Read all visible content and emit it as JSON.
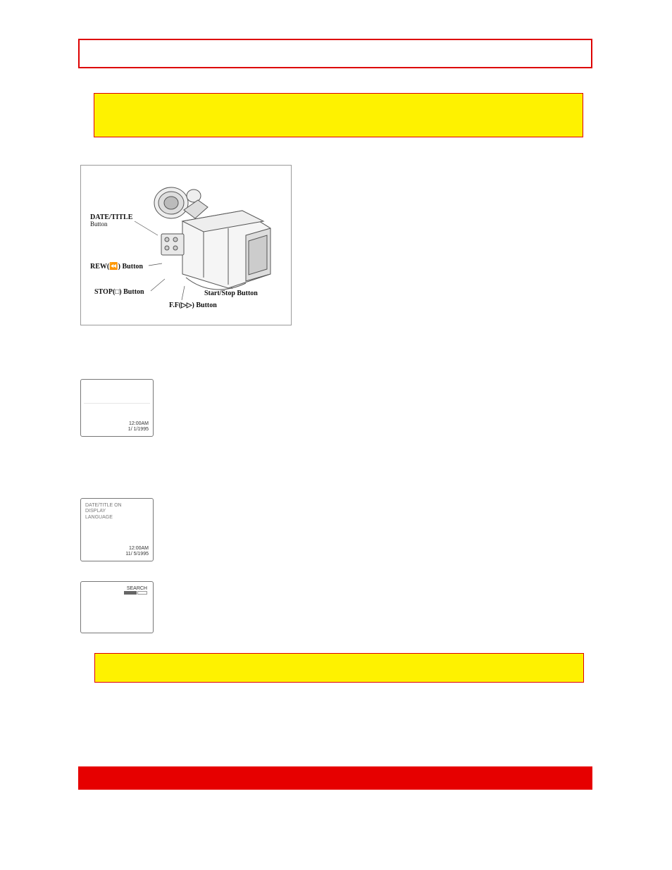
{
  "figure_main": {
    "labels": {
      "date_title": {
        "line1": "DATE/TITLE",
        "line2": "Button"
      },
      "rew": "REW(⏪) Button",
      "stop": "STOP(□) Button",
      "ff": "F.F(▷▷) Button",
      "startstop": "Start/Stop Button"
    }
  },
  "thumbs": {
    "t1": {
      "line1": "12:00AM",
      "line2": "1/ 1/1995"
    },
    "t2": {
      "menu": [
        "DATE/TITLE  ON",
        "DISPLAY",
        "LANGUAGE"
      ],
      "line1": "12:00AM",
      "line2": "11/ 5/1995"
    },
    "t3": {
      "label": "SEARCH",
      "bar": "■■"
    }
  }
}
